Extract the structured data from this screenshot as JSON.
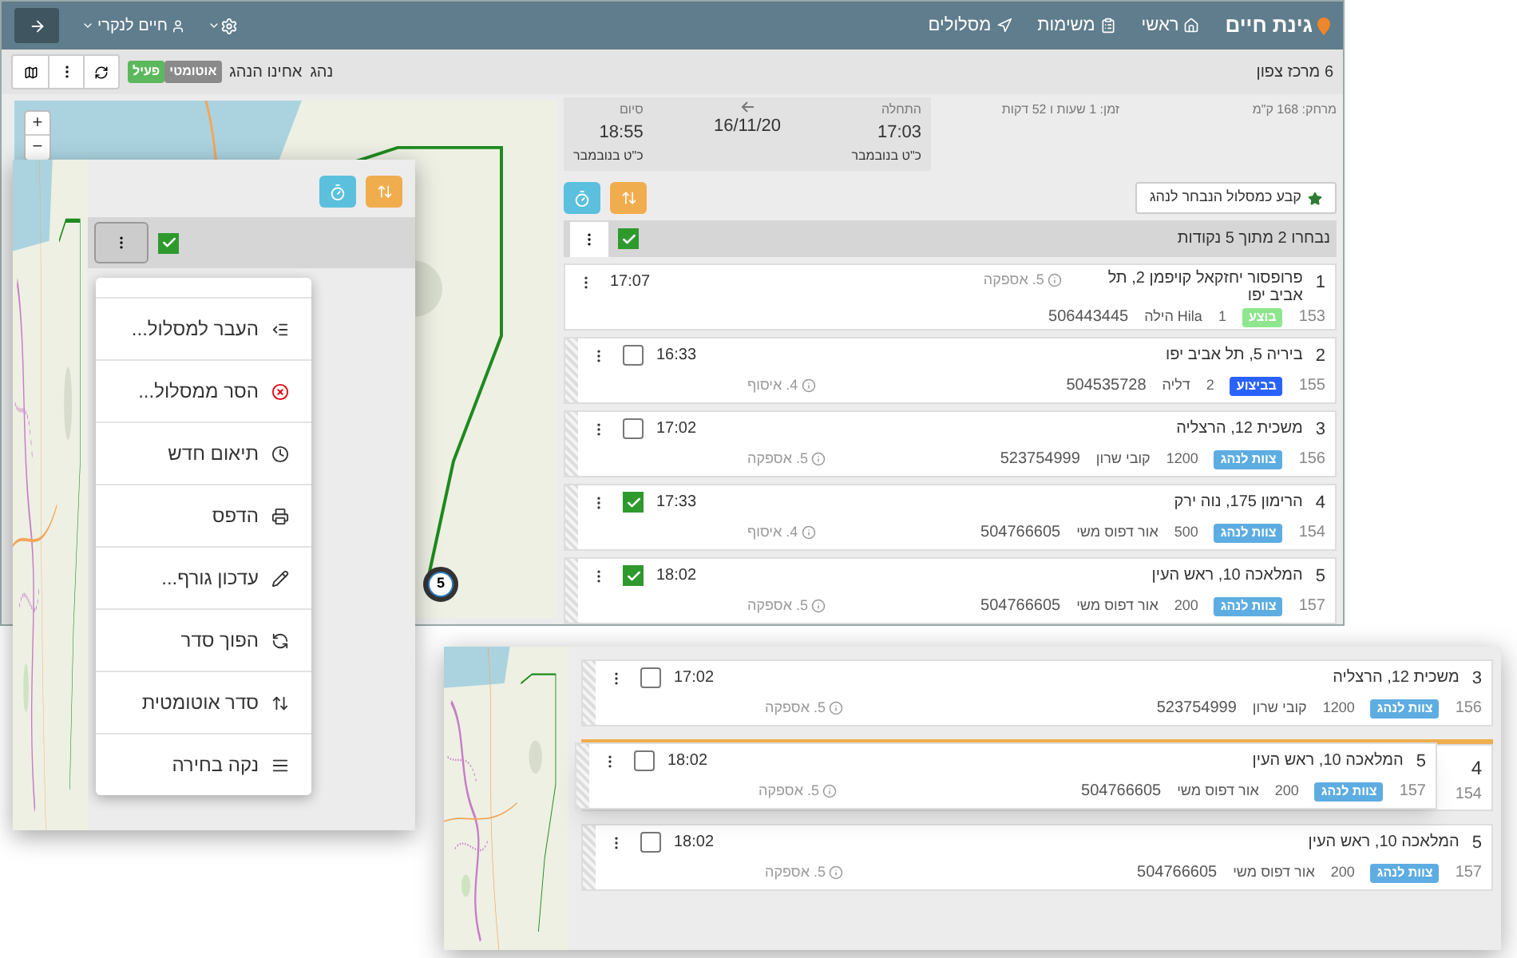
{
  "topbar": {
    "brand": "גינת חיים",
    "nav": [
      {
        "label": "ראשי"
      },
      {
        "label": "משימות"
      },
      {
        "label": "מסלולים"
      }
    ],
    "user": "חיים לנקרי"
  },
  "toolbar": {
    "route_name": "6 מרכז צפון",
    "driver_label": "נהג",
    "driver_name": "אחינו הנהג",
    "status_badges": [
      {
        "label": "אוטומטי",
        "color": "#8a8a8a"
      },
      {
        "label": "פעיל",
        "color": "#5cb85c"
      }
    ]
  },
  "map": {
    "zoom_in": "+",
    "zoom_out": "−",
    "marker_label": "5"
  },
  "summary": {
    "distance": "מרחק: 168 ק\"מ",
    "duration": "זמן: 1 שעות ו 52 דקות",
    "start_label": "התחלה",
    "start_time": "17:03",
    "start_date": "כ\"ט בנובמבר",
    "date": "16/11/20",
    "end_label": "סיום",
    "end_time": "18:55",
    "end_date": "כ\"ט בנובמבר"
  },
  "assign_button": "קבע כמסלול הנבחר לנהג",
  "selection": {
    "label": "נבחרו 2 מתוך 5 נקודות",
    "checked": true
  },
  "stops": [
    {
      "kind": "locked",
      "index": "1",
      "address": "פרופסור יחזקאל קויפמן 2, תל אביב יפו",
      "time": "17:07",
      "id": "153",
      "badge": "בוצע",
      "color": "#8ee68e",
      "qty": "1",
      "name": "Hila הילה",
      "phone": "506443445",
      "task": "5. אספקה"
    },
    {
      "kind": "stop",
      "index": "2",
      "address": "ביריה 5, תל אביב יפו",
      "time": "16:33",
      "checked": false,
      "id": "155",
      "badge": "בביצוע",
      "color": "#2962ff",
      "qty": "2",
      "name": "דליה",
      "phone": "504535728",
      "task": "4. איסוף"
    },
    {
      "kind": "stop",
      "index": "3",
      "address": "משכית 12, הרצליה",
      "time": "17:02",
      "checked": false,
      "id": "156",
      "badge": "צוות לנהג",
      "color": "#5dade2",
      "qty": "1200",
      "name": "קובי שרון",
      "phone": "523754999",
      "task": "5. אספקה"
    },
    {
      "kind": "stop",
      "index": "4",
      "address": "הרימון 175, נוה ירק",
      "time": "17:33",
      "checked": true,
      "id": "154",
      "badge": "צוות לנהג",
      "color": "#5dade2",
      "qty": "500",
      "name": "אור דפוס משי",
      "phone": "504766605",
      "task": "4. איסוף"
    },
    {
      "kind": "stop",
      "index": "5",
      "address": "המלאכה 10, ראש העין",
      "time": "18:02",
      "checked": true,
      "id": "157",
      "badge": "צוות לנהג",
      "color": "#5dade2",
      "qty": "200",
      "name": "אור דפוס משי",
      "phone": "504766605",
      "task": "5. אספקה"
    }
  ],
  "popup": {
    "checked": true,
    "menu": [
      {
        "label": "העבר למסלול..."
      },
      {
        "label": "הסר ממסלול..."
      },
      {
        "label": "תיאום חדש"
      },
      {
        "label": "הדפס"
      },
      {
        "label": "עדכון גורף..."
      },
      {
        "label": "הפוך סדר"
      },
      {
        "label": "סדר אוטומטית"
      },
      {
        "label": "נקה בחירה"
      }
    ]
  },
  "drag_demo": {
    "rows": [
      {
        "kind": "stop",
        "index": "3",
        "address": "משכית 12, הרצליה",
        "time": "17:02",
        "checked": false,
        "id": "156",
        "badge": "צוות לנהג",
        "color": "#5dade2",
        "qty": "1200",
        "name": "קובי שרון",
        "phone": "523754999",
        "task": "5. אספקה"
      },
      {
        "kind": "ghost",
        "index": "4",
        "id": "154"
      },
      {
        "kind": "stop",
        "index": "5",
        "address": "המלאכה 10, ראש העין",
        "time": "18:02",
        "checked": false,
        "id": "157",
        "badge": "צוות לנהג",
        "color": "#5dade2",
        "qty": "200",
        "name": "אור דפוס משי",
        "phone": "504766605",
        "task": "5. אספקה"
      }
    ],
    "dragged": {
      "index": "5",
      "address": "המלאכה 10, ראש העין",
      "time": "18:02",
      "checked": false,
      "id": "157",
      "badge": "צוות לנהג",
      "color": "#5dade2",
      "qty": "200",
      "name": "אור דפוס משי",
      "phone": "504766605",
      "task": "5. אספקה"
    }
  }
}
